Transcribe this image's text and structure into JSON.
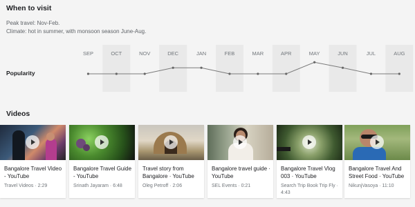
{
  "visit": {
    "title": "When to visit",
    "peak": "Peak travel: Nov-Feb.",
    "climate": "Climate: hot in summer, with monsoon season June-Aug."
  },
  "popularity": {
    "label": "Popularity",
    "months": [
      "SEP",
      "OCT",
      "NOV",
      "DEC",
      "JAN",
      "FEB",
      "MAR",
      "APR",
      "MAY",
      "JUN",
      "JUL",
      "AUG"
    ],
    "highlighted": [
      false,
      true,
      false,
      true,
      false,
      true,
      false,
      true,
      false,
      true,
      false,
      true
    ],
    "values": [
      0.3,
      0.3,
      0.3,
      0.5,
      0.5,
      0.3,
      0.3,
      0.3,
      0.68,
      0.5,
      0.3,
      0.3
    ],
    "colors": {
      "line": "#7a7a7a",
      "band": "#e9e9e9"
    }
  },
  "videos": {
    "title": "Videos",
    "items": [
      {
        "title": "Bangalore Travel Video - YouTube",
        "channel": "Travel Videos",
        "duration": "2:29",
        "thumb": "people"
      },
      {
        "title": "Bangalore Travel Guide - YouTube",
        "channel": "Srinath Jayaram",
        "duration": "6:48",
        "thumb": "grapes"
      },
      {
        "title": "Travel story from Bangalore · YouTube",
        "channel": "Oleg Petroff",
        "duration": "2:06",
        "thumb": "palace"
      },
      {
        "title": "Bangalore travel guide · YouTube",
        "channel": "SEL Events",
        "duration": "0:21",
        "thumb": "woman"
      },
      {
        "title": "Bangalore Travel Vlog 003 · YouTube",
        "channel": "Search Trip Book Trip Fly",
        "duration": "4:43",
        "thumb": "bamboo"
      },
      {
        "title": "Bangalore Travel And Street Food · YouTube",
        "channel": "NikunjVasoya",
        "duration": "11:10",
        "thumb": "man"
      }
    ]
  }
}
